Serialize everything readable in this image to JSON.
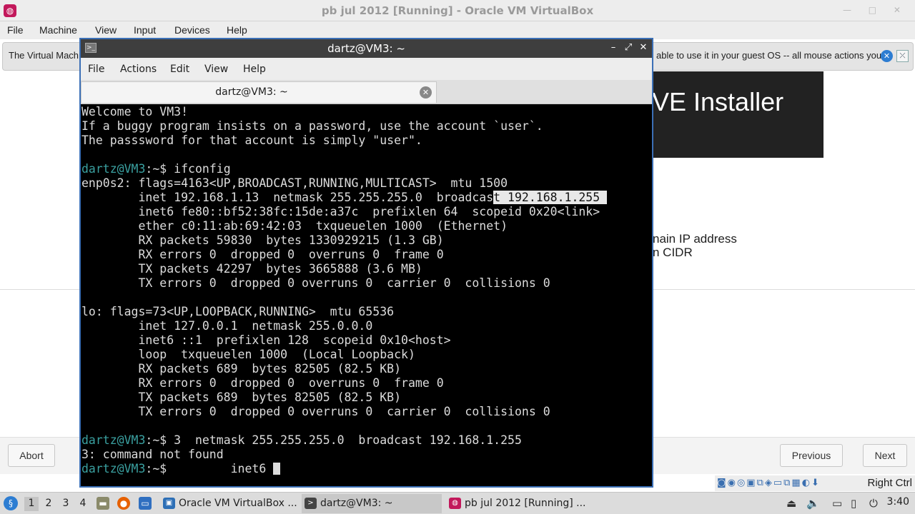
{
  "window": {
    "title": "pb jul 2012 [Running] - Oracle VM VirtualBox",
    "menu": [
      "File",
      "Machine",
      "View",
      "Input",
      "Devices",
      "Help"
    ]
  },
  "notification": {
    "left_text": "The Virtual Mach",
    "right_text": "able to use it in your guest OS -- all mouse actions you"
  },
  "guest": {
    "banner_title": "VE Installer",
    "text_line1": "nain IP address",
    "text_line2": "n CIDR",
    "buttons": {
      "abort": "Abort",
      "previous": "Previous",
      "next": "Next"
    }
  },
  "terminal": {
    "title": "dartz@VM3: ~",
    "menu": [
      "File",
      "Actions",
      "Edit",
      "View",
      "Help"
    ],
    "tab_label": "dartz@VM3: ~",
    "lines": [
      {
        "text": "Welcome to VM3!"
      },
      {
        "text": "If a buggy program insists on a password, use the account `user`."
      },
      {
        "text": "The passsword for that account is simply \"user\"."
      },
      {
        "text": ""
      },
      {
        "prompt": "dartz@VM3",
        "suffix": ":~$ ",
        "text": "ifconfig"
      },
      {
        "text": "enp0s2: flags=4163<UP,BROADCAST,RUNNING,MULTICAST>  mtu 1500"
      },
      {
        "text": "        inet 192.168.1.13  netmask 255.255.255.0  broadcas",
        "selected": "t 192.168.1.255 "
      },
      {
        "text": "        inet6 fe80::bf52:38fc:15de:a37c  prefixlen 64  scopeid 0x20<link>"
      },
      {
        "text": "        ether c0:11:ab:69:42:03  txqueuelen 1000  (Ethernet)"
      },
      {
        "text": "        RX packets 59830  bytes 1330929215 (1.3 GB)"
      },
      {
        "text": "        RX errors 0  dropped 0  overruns 0  frame 0"
      },
      {
        "text": "        TX packets 42297  bytes 3665888 (3.6 MB)"
      },
      {
        "text": "        TX errors 0  dropped 0 overruns 0  carrier 0  collisions 0"
      },
      {
        "text": ""
      },
      {
        "text": "lo: flags=73<UP,LOOPBACK,RUNNING>  mtu 65536"
      },
      {
        "text": "        inet 127.0.0.1  netmask 255.0.0.0"
      },
      {
        "text": "        inet6 ::1  prefixlen 128  scopeid 0x10<host>"
      },
      {
        "text": "        loop  txqueuelen 1000  (Local Loopback)"
      },
      {
        "text": "        RX packets 689  bytes 82505 (82.5 KB)"
      },
      {
        "text": "        RX errors 0  dropped 0  overruns 0  frame 0"
      },
      {
        "text": "        TX packets 689  bytes 82505 (82.5 KB)"
      },
      {
        "text": "        TX errors 0  dropped 0 overruns 0  carrier 0  collisions 0"
      },
      {
        "text": ""
      },
      {
        "prompt": "dartz@VM3",
        "suffix": ":~$ ",
        "text": "3  netmask 255.255.255.0  broadcast 192.168.1.255"
      },
      {
        "text": "3: command not found"
      },
      {
        "prompt": "dartz@VM3",
        "suffix": ":~$ ",
        "text": "        inet6 ",
        "cursor": true
      }
    ]
  },
  "statusbar": {
    "host_key": "Right Ctrl"
  },
  "taskbar": {
    "workspaces": [
      "1",
      "2",
      "3",
      "4"
    ],
    "active_workspace": "1",
    "tasks": [
      "Oracle VM VirtualBox ...",
      "dartz@VM3: ~",
      "pb jul 2012 [Running] ..."
    ],
    "active_task": 1,
    "clock": "3:40"
  },
  "colors": {
    "prompt": "#3aa0a0",
    "terminal_bg": "#000000",
    "terminal_fg": "#dcdcdc",
    "accent": "#2d7dd2"
  }
}
